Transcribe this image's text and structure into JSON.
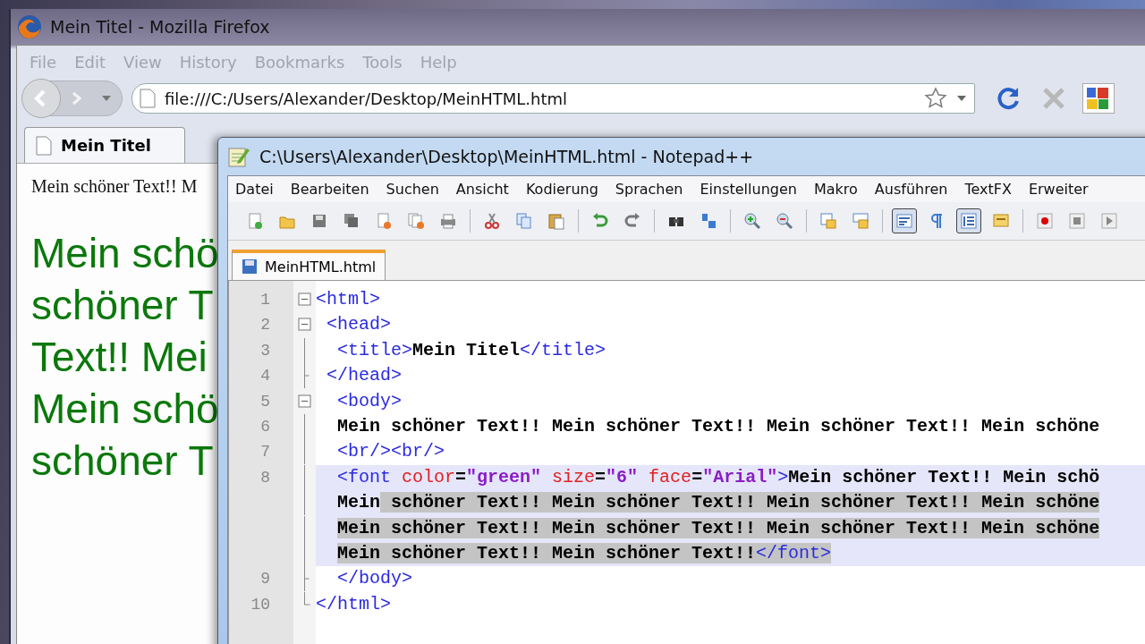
{
  "browser": {
    "title": "Mein Titel - Mozilla Firefox",
    "menu": [
      "File",
      "Edit",
      "View",
      "History",
      "Bookmarks",
      "Tools",
      "Help"
    ],
    "url": "file:///C:/Users/Alexander/Desktop/MeinHTML.html",
    "tabs": [
      {
        "label": "Mein Titel",
        "selected": true
      }
    ],
    "content": {
      "paragraph": "Mein schöner Text!! M",
      "big_lines": [
        "Mein schö",
        "schöner T",
        "Text!! Mei",
        "Mein schö",
        "schöner T"
      ]
    }
  },
  "editor": {
    "title": "C:\\Users\\Alexander\\Desktop\\MeinHTML.html - Notepad++",
    "menu": [
      "Datei",
      "Bearbeiten",
      "Suchen",
      "Ansicht",
      "Kodierung",
      "Sprachen",
      "Einstellungen",
      "Makro",
      "Ausführen",
      "TextFX",
      "Erweiter"
    ],
    "toolbar": [
      [
        {
          "kind": "new-file",
          "pressed": false
        },
        {
          "kind": "open",
          "pressed": false
        },
        {
          "kind": "save",
          "pressed": false
        },
        {
          "kind": "save-all",
          "pressed": false
        },
        {
          "kind": "close",
          "pressed": false
        },
        {
          "kind": "close-all",
          "pressed": false
        },
        {
          "kind": "print",
          "pressed": false
        }
      ],
      [
        {
          "kind": "cut",
          "pressed": false
        },
        {
          "kind": "copy",
          "pressed": false
        },
        {
          "kind": "paste",
          "pressed": false
        }
      ],
      [
        {
          "kind": "undo",
          "pressed": false
        },
        {
          "kind": "redo",
          "pressed": false
        }
      ],
      [
        {
          "kind": "find",
          "pressed": false
        },
        {
          "kind": "replace",
          "pressed": false
        }
      ],
      [
        {
          "kind": "zoom-in",
          "pressed": false
        },
        {
          "kind": "zoom-out",
          "pressed": false
        }
      ],
      [
        {
          "kind": "sync-vertical",
          "pressed": false
        },
        {
          "kind": "sync-horizontal",
          "pressed": false
        }
      ],
      [
        {
          "kind": "word-wrap",
          "pressed": true
        },
        {
          "kind": "show-symbols",
          "pressed": false
        },
        {
          "kind": "indent-guide",
          "pressed": true
        },
        {
          "kind": "panel",
          "pressed": false
        }
      ],
      [
        {
          "kind": "record",
          "pressed": false
        },
        {
          "kind": "stop",
          "pressed": false
        },
        {
          "kind": "play",
          "pressed": false
        }
      ]
    ],
    "tabs": [
      {
        "label": "MeinHTML.html",
        "selected": true
      }
    ],
    "lines": [
      {
        "number": "1",
        "kind": "open",
        "current": false,
        "rows": [
          [
            {
              "kind": "tag",
              "text": "<html>",
              "selected": false
            }
          ]
        ]
      },
      {
        "number": "2",
        "kind": "open",
        "current": false,
        "rows": [
          [
            {
              "kind": "tag",
              "text": " <head>",
              "selected": false
            }
          ]
        ]
      },
      {
        "number": "3",
        "kind": "line",
        "current": false,
        "rows": [
          [
            {
              "kind": "tag",
              "text": "  <title>",
              "selected": false
            },
            {
              "kind": "text",
              "text": "Mein Titel",
              "selected": false
            },
            {
              "kind": "tag",
              "text": "</title>",
              "selected": false
            }
          ]
        ]
      },
      {
        "number": "4",
        "kind": "end",
        "current": false,
        "rows": [
          [
            {
              "kind": "tag",
              "text": " </head>",
              "selected": false
            }
          ]
        ]
      },
      {
        "number": "5",
        "kind": "open",
        "current": false,
        "rows": [
          [
            {
              "kind": "tag",
              "text": "  <body>",
              "selected": false
            }
          ]
        ]
      },
      {
        "number": "6",
        "kind": "line",
        "current": false,
        "rows": [
          [
            {
              "kind": "text",
              "text": "  Mein schöner Text!! Mein schöner Text!! Mein schöner Text!! Mein schöne",
              "selected": false
            }
          ]
        ]
      },
      {
        "number": "7",
        "kind": "line",
        "current": false,
        "rows": [
          [
            {
              "kind": "tag",
              "text": "  <br/><br/>",
              "selected": false
            }
          ]
        ]
      },
      {
        "number": "8",
        "kind": "line",
        "current": true,
        "rows": [
          [
            {
              "kind": "tag",
              "text": "  <font",
              "selected": false
            },
            {
              "kind": "attr",
              "text": " color",
              "selected": false
            },
            {
              "kind": "text",
              "text": "=",
              "selected": false
            },
            {
              "kind": "value",
              "text": "\"green\"",
              "selected": false
            },
            {
              "kind": "attr",
              "text": " size",
              "selected": false
            },
            {
              "kind": "text",
              "text": "=",
              "selected": false
            },
            {
              "kind": "value",
              "text": "\"6\"",
              "selected": false
            },
            {
              "kind": "attr",
              "text": " face",
              "selected": false
            },
            {
              "kind": "text",
              "text": "=",
              "selected": false
            },
            {
              "kind": "value",
              "text": "\"Arial\"",
              "selected": false
            },
            {
              "kind": "tag",
              "text": ">",
              "selected": false
            },
            {
              "kind": "text",
              "text": "Mein schöner Text!! Mein schö",
              "selected": false
            }
          ],
          [
            {
              "kind": "text",
              "text": "Mein",
              "selected": false
            },
            {
              "kind": "text",
              "text": " schöner Text!! Mein schöner Text!! Mein schöner Text!! Mein schöne",
              "selected": true
            }
          ],
          [
            {
              "kind": "text",
              "text": "Mein schöner Text!! Mein schöner Text!! Mein schöner Text!! Mein schöne",
              "selected": true
            }
          ],
          [
            {
              "kind": "text",
              "text": "Mein schöner Text!! Mein schöner Text!!",
              "selected": true
            },
            {
              "kind": "tag",
              "text": "</font>",
              "selected": true
            }
          ]
        ]
      },
      {
        "number": "9",
        "kind": "end",
        "current": false,
        "rows": [
          [
            {
              "kind": "tag",
              "text": "  </body>",
              "selected": false
            }
          ]
        ]
      },
      {
        "number": "10",
        "kind": "last",
        "current": false,
        "rows": [
          [
            {
              "kind": "tag",
              "text": "</html>",
              "selected": false
            }
          ]
        ]
      }
    ]
  }
}
